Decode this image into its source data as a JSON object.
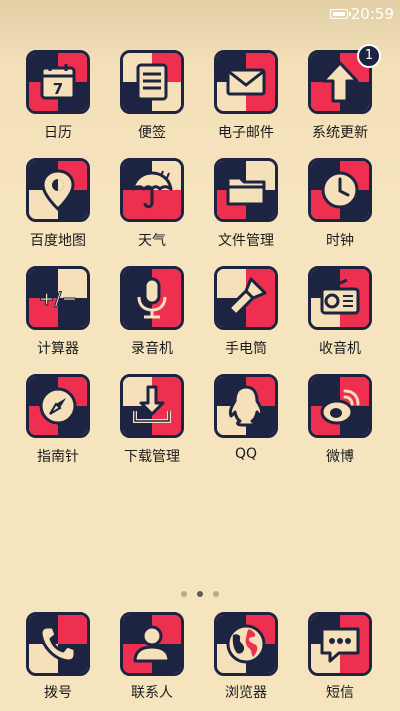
{
  "status_bar": {
    "time": "20:59",
    "battery_icon": "battery-icon"
  },
  "colors": {
    "navy": "#1c2441",
    "red": "#ef2f4f",
    "cream": "#f5e0b9",
    "background": "#f6e4bf"
  },
  "apps": [
    {
      "label": "日历",
      "icon": "calendar-icon",
      "calendar_day": "7"
    },
    {
      "label": "便签",
      "icon": "notes-icon"
    },
    {
      "label": "电子邮件",
      "icon": "mail-icon"
    },
    {
      "label": "系统更新",
      "icon": "update-arrow-icon",
      "badge": "1"
    },
    {
      "label": "百度地图",
      "icon": "map-pin-icon"
    },
    {
      "label": "天气",
      "icon": "umbrella-icon"
    },
    {
      "label": "文件管理",
      "icon": "folder-icon"
    },
    {
      "label": "时钟",
      "icon": "clock-icon"
    },
    {
      "label": "计算器",
      "icon": "calculator-icon",
      "symbol": "+/−"
    },
    {
      "label": "录音机",
      "icon": "microphone-icon"
    },
    {
      "label": "手电筒",
      "icon": "flashlight-icon"
    },
    {
      "label": "收音机",
      "icon": "radio-icon"
    },
    {
      "label": "指南针",
      "icon": "compass-icon"
    },
    {
      "label": "下载管理",
      "icon": "download-icon"
    },
    {
      "label": "QQ",
      "icon": "penguin-icon"
    },
    {
      "label": "微博",
      "icon": "weibo-icon"
    }
  ],
  "dock": [
    {
      "label": "拨号",
      "icon": "phone-icon"
    },
    {
      "label": "联系人",
      "icon": "contact-icon"
    },
    {
      "label": "浏览器",
      "icon": "globe-icon"
    },
    {
      "label": "短信",
      "icon": "message-icon"
    }
  ],
  "pager": {
    "pages": 3,
    "active": 2
  }
}
